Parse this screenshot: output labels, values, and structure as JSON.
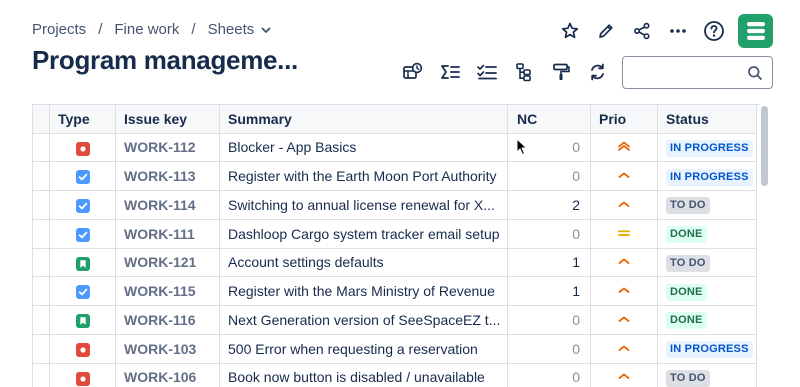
{
  "breadcrumb": {
    "project": "Projects",
    "space": "Fine work",
    "view": "Sheets",
    "separator": "/"
  },
  "page": {
    "title": "Program manageme..."
  },
  "search": {
    "placeholder": "",
    "value": ""
  },
  "colors": {
    "accent_green": "#22a06b",
    "in_progress_bg": "#e9f2ff",
    "in_progress_fg": "#0055cc",
    "todo_bg": "#dcdfe4",
    "todo_fg": "#44546f",
    "done_bg": "#dcfff1",
    "done_fg": "#216e4e",
    "bug": "#e2483d",
    "task": "#4c9aff",
    "story": "#22a06b",
    "prio_high": "#e56910",
    "prio_medium": "#e2b203"
  },
  "table": {
    "columns": [
      "Type",
      "Issue key",
      "Summary",
      "NC",
      "Prio",
      "Status"
    ],
    "rows": [
      {
        "type": "bug-icon",
        "key": "WORK-112",
        "summary": "Blocker - App Basics",
        "nc": "0",
        "prio": "highest",
        "status": "IN PROGRESS"
      },
      {
        "type": "task-icon",
        "key": "WORK-113",
        "summary": "Register with the Earth Moon Port Authority",
        "nc": "0",
        "prio": "high",
        "status": "IN PROGRESS"
      },
      {
        "type": "task-icon",
        "key": "WORK-114",
        "summary": "Switching to annual license renewal for X...",
        "nc": "2",
        "prio": "high",
        "status": "TO DO"
      },
      {
        "type": "task-icon",
        "key": "WORK-111",
        "summary": "Dashloop Cargo system tracker email setup",
        "nc": "0",
        "prio": "medium",
        "status": "DONE"
      },
      {
        "type": "story-icon",
        "key": "WORK-121",
        "summary": "Account settings defaults",
        "nc": "1",
        "prio": "high",
        "status": "TO DO"
      },
      {
        "type": "task-icon",
        "key": "WORK-115",
        "summary": "Register with the Mars Ministry of Revenue",
        "nc": "1",
        "prio": "high",
        "status": "DONE"
      },
      {
        "type": "story-icon",
        "key": "WORK-116",
        "summary": "Next Generation version of SeeSpaceEZ t...",
        "nc": "0",
        "prio": "high",
        "status": "DONE"
      },
      {
        "type": "bug-icon",
        "key": "WORK-103",
        "summary": "500 Error when requesting a reservation",
        "nc": "0",
        "prio": "high",
        "status": "IN PROGRESS"
      },
      {
        "type": "bug-icon",
        "key": "WORK-106",
        "summary": "Book now button is disabled / unavailable",
        "nc": "0",
        "prio": "high",
        "status": "TO DO"
      }
    ]
  }
}
